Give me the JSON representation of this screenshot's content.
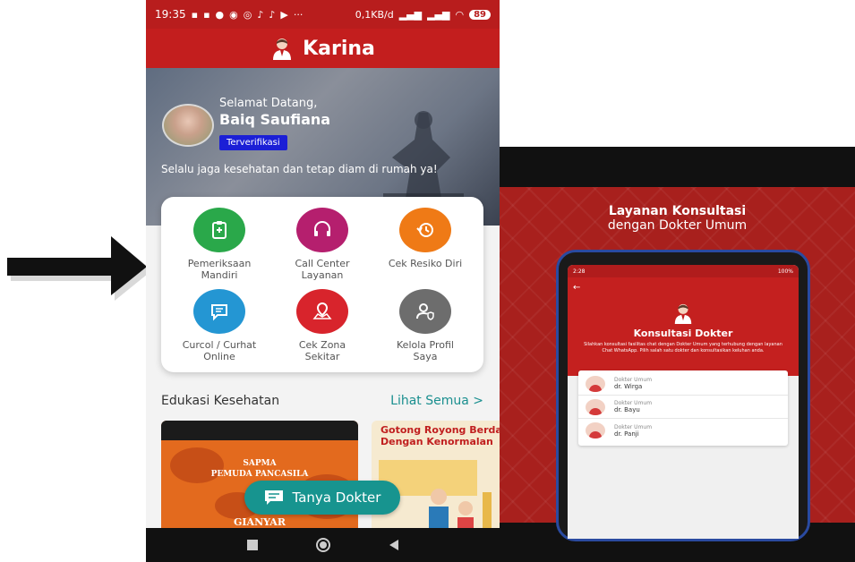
{
  "status_bar": {
    "time": "19:35",
    "network_speed": "0,1KB/d",
    "battery": "89"
  },
  "app": {
    "title": "Karina"
  },
  "profile": {
    "greeting": "Selamat Datang,",
    "name": "Baiq Saufiana",
    "badge": "Terverifikasi",
    "tagline": "Selalu jaga kesehatan dan tetap diam di rumah ya!"
  },
  "menu": [
    {
      "label_1": "Pemeriksaan",
      "label_2": "Mandiri",
      "icon": "clipboard-icon",
      "color": "#2aa84a"
    },
    {
      "label_1": "Call Center",
      "label_2": "Layanan",
      "icon": "headset-icon",
      "color": "#b51f6e"
    },
    {
      "label_1": "Cek Resiko Diri",
      "label_2": "",
      "icon": "history-icon",
      "color": "#ef7a16"
    },
    {
      "label_1": "Curcol / Curhat",
      "label_2": "Online",
      "icon": "chat-icon",
      "color": "#2496d3"
    },
    {
      "label_1": "Cek Zona",
      "label_2": "Sekitar",
      "icon": "map-icon",
      "color": "#d8242c"
    },
    {
      "label_1": "Kelola Profil",
      "label_2": "Saya",
      "icon": "user-shield-icon",
      "color": "#6d6d6d"
    }
  ],
  "education": {
    "title": "Edukasi Kesehatan",
    "see_all": "Lihat Semua >",
    "card1": {
      "line1": "SAPMA",
      "line2": "PEMUDA PANCASILA",
      "line3": "GIANYAR"
    },
    "card2": {
      "line1": "Gotong Royong Berda",
      "line2": "Dengan Kenormalan"
    }
  },
  "fab": {
    "label": "Tanya Dokter"
  },
  "consult_screen": {
    "title_line1": "Layanan Konsultasi",
    "title_line2": "dengan Dokter Umum",
    "inner_status_time": "2:28",
    "inner_status_right": "100%",
    "inner_title": "Konsultasi Dokter",
    "inner_desc": "Silahkan konsultasi fasilitas chat dengan Dokter Umum yang terhubung dengan layanan Chat WhatsApp. Pilih salah satu dokter dan konsultasikan keluhan anda.",
    "doctors": [
      {
        "role": "Dokter Umum",
        "name": "dr. Wirga"
      },
      {
        "role": "Dokter Umum",
        "name": "dr. Bayu"
      },
      {
        "role": "Dokter Umum",
        "name": "dr. Panji"
      }
    ]
  }
}
